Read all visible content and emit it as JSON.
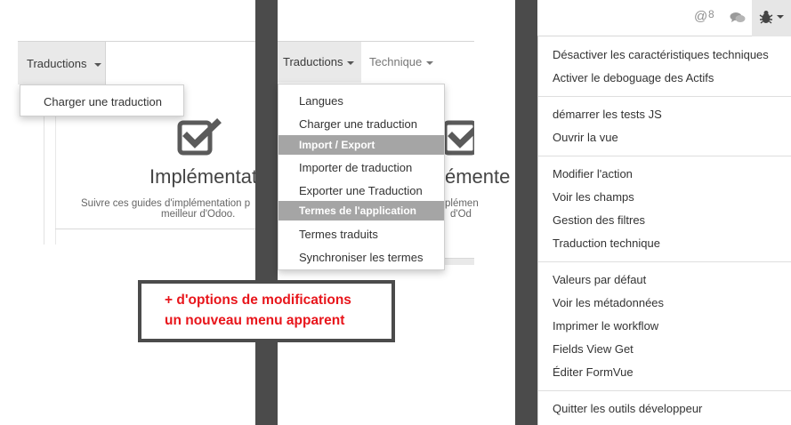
{
  "panel1": {
    "tab_label": "Traductions",
    "dropdown_items": [
      "Charger une traduction"
    ],
    "card": {
      "title": "Implémentat",
      "description_line1": "Suivre ces guides d'implémentation p",
      "description_line2": "meilleur d'Odoo."
    }
  },
  "panel2": {
    "tab_label": "Traductions",
    "tab2_label": "Technique",
    "dropdown_items": [
      {
        "label": "Langues",
        "header": false
      },
      {
        "label": "Charger une traduction",
        "header": false
      },
      {
        "label": "Import / Export",
        "header": true
      },
      {
        "label": "Importer de traduction",
        "header": false
      },
      {
        "label": "Exporter une Traduction",
        "header": false
      },
      {
        "label": "Termes de l'application",
        "header": true
      },
      {
        "label": "Termes traduits",
        "header": false
      },
      {
        "label": "Synchroniser les termes",
        "header": false
      }
    ],
    "card": {
      "title": "émente",
      "description_line1": "plémen",
      "description_line2": "d'Od"
    }
  },
  "callout": {
    "line1": "+ d'options de modifications",
    "line2": "un nouveau menu apparent"
  },
  "panel3": {
    "mentions_count": "8",
    "icons": [
      "at-icon",
      "chat-icon",
      "bug-icon"
    ],
    "menu_groups": [
      [
        "Désactiver les caractéristiques techniques",
        "Activer le deboguage des Actifs"
      ],
      [
        "démarrer les tests JS",
        "Ouvrir la vue"
      ],
      [
        "Modifier l'action",
        "Voir les champs",
        "Gestion des filtres",
        "Traduction technique"
      ],
      [
        "Valeurs par défaut",
        "Voir les métadonnées",
        "Imprimer le workflow",
        "Fields View Get",
        "Éditer FormVue"
      ],
      [
        "Quitter les outils développeur"
      ]
    ]
  },
  "colors": {
    "divider": "#4b4b4b",
    "tab_active_bg": "#e9e9e9",
    "dropdown_header_bg": "#a5a5a5",
    "callout_text": "#e8151b"
  }
}
